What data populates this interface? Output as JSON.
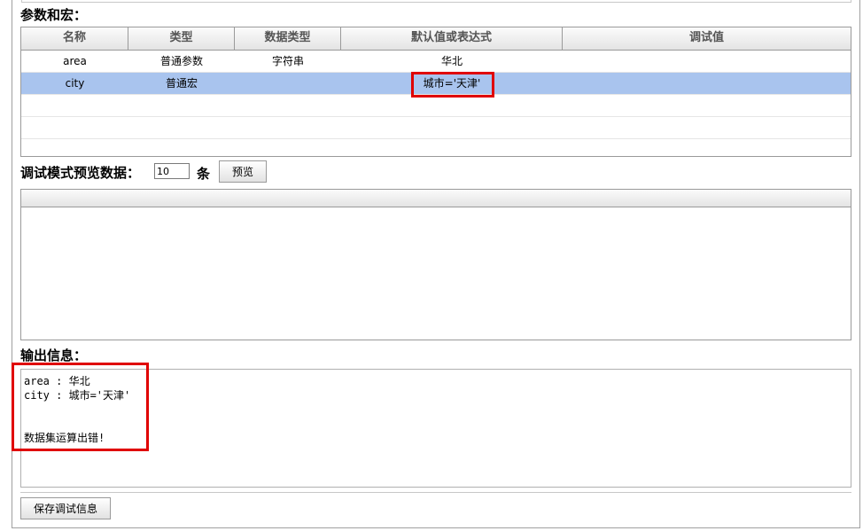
{
  "params_section": {
    "title": "参数和宏：",
    "columns": [
      "名称",
      "类型",
      "数据类型",
      "默认值或表达式",
      "调试值"
    ],
    "rows": [
      {
        "name": "area",
        "type": "普通参数",
        "data_type": "字符串",
        "default": "华北",
        "debug": ""
      },
      {
        "name": "city",
        "type": "普通宏",
        "data_type": "",
        "default": "城市='天津'",
        "debug": "",
        "selected": true
      }
    ]
  },
  "preview": {
    "label": "调试模式预览数据：",
    "row_count": "10",
    "unit": "条",
    "button_label": "预览"
  },
  "output": {
    "title": "输出信息：",
    "lines": [
      "area : 华北",
      "city : 城市='天津'",
      "",
      "",
      "数据集运算出错!"
    ]
  },
  "save_button_label": "保存调试信息",
  "colors": {
    "selected_row": "#a9c4ee",
    "highlight": "#e00000"
  }
}
